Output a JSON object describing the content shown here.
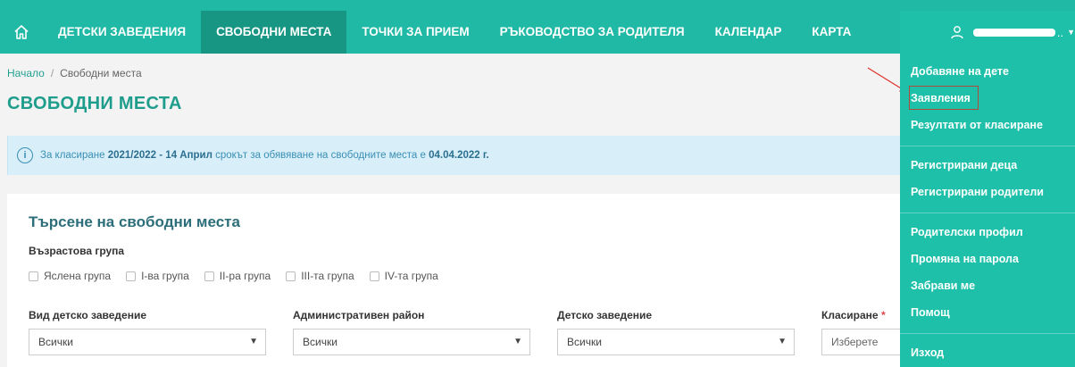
{
  "nav": {
    "items": [
      {
        "label": "ДЕТСКИ ЗАВЕДЕНИЯ"
      },
      {
        "label": "СВОБОДНИ МЕСТА",
        "active": true
      },
      {
        "label": "ТОЧКИ ЗА ПРИЕМ"
      },
      {
        "label": "РЪКОВОДСТВО ЗА РОДИТЕЛЯ"
      },
      {
        "label": "КАЛЕНДАР"
      },
      {
        "label": "КАРТА"
      }
    ],
    "user_suffix": "..",
    "icons": {
      "home": "home-icon",
      "user": "user-icon",
      "caret": "caret-down-icon"
    },
    "colors": {
      "bar": "#20b9a5",
      "active": "#189684"
    }
  },
  "breadcrumb": {
    "home": "Начало",
    "separator": "/",
    "current": "Свободни места"
  },
  "page_title": "СВОБОДНИ МЕСТА",
  "alert": {
    "prefix": "За класиране ",
    "period": "2021/2022 - 14 Април",
    "middle": " срокът за обявяване на свободните места е ",
    "date": "04.04.2022 г.",
    "icon": "info-icon"
  },
  "search": {
    "title": "Търсене на свободни места",
    "age_group_label": "Възрастова група",
    "age_groups": [
      "Яслена група",
      "I-ва група",
      "II-ра група",
      "III-та група",
      "IV-та група"
    ],
    "fields": [
      {
        "label": "Вид детско заведение",
        "value": "Всички",
        "required": false
      },
      {
        "label": "Административен район",
        "value": "Всички",
        "required": false
      },
      {
        "label": "Детско заведение",
        "value": "Всички",
        "required": false
      },
      {
        "label": "Класиране",
        "value": "Изберете",
        "required": true
      }
    ],
    "required_mark": "*"
  },
  "menu": {
    "items": [
      "Добавяне на дете",
      "Заявления",
      "Резултати от класиране",
      "Регистрирани деца",
      "Регистрирани родители",
      "Родителски профил",
      "Промяна на парола",
      "Забрави ме",
      "Помощ",
      "Изход"
    ],
    "highlighted": "Заявления",
    "highlight_color": "#b04a3a"
  }
}
